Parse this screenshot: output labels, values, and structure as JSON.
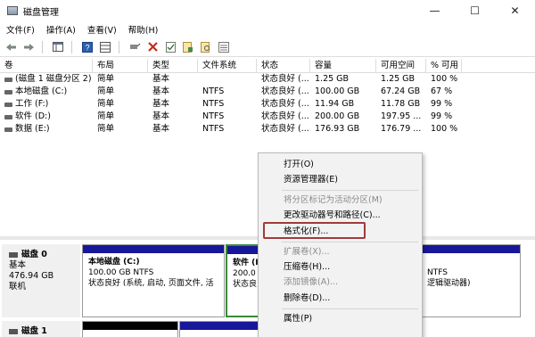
{
  "window": {
    "title": "磁盘管理",
    "minimize": "—",
    "maximize": "☐",
    "close": "✕"
  },
  "menu": [
    "文件(F)",
    "操作(A)",
    "查看(V)",
    "帮助(H)"
  ],
  "toolbar_icons": [
    "back-icon",
    "forward-icon",
    "show-hide-console-icon",
    "help-icon",
    "connect-icon",
    "delete-icon",
    "check-icon",
    "properties-icon",
    "search-icon",
    "list-icon"
  ],
  "list": {
    "headers": [
      "卷",
      "布局",
      "类型",
      "文件系统",
      "状态",
      "容量",
      "可用空间",
      "% 可用"
    ],
    "rows": [
      [
        "(磁盘 1 磁盘分区 2)",
        "简单",
        "基本",
        "",
        "状态良好 (...",
        "1.25 GB",
        "1.25 GB",
        "100 %"
      ],
      [
        "本地磁盘 (C:)",
        "简单",
        "基本",
        "NTFS",
        "状态良好 (...",
        "100.00 GB",
        "67.24 GB",
        "67 %"
      ],
      [
        "工作 (F:)",
        "简单",
        "基本",
        "NTFS",
        "状态良好 (...",
        "11.94 GB",
        "11.78 GB",
        "99 %"
      ],
      [
        "软件 (D:)",
        "简单",
        "基本",
        "NTFS",
        "状态良好 (...",
        "200.00 GB",
        "197.95 ...",
        "99 %"
      ],
      [
        "数据 (E:)",
        "简单",
        "基本",
        "NTFS",
        "状态良好 (...",
        "176.93 GB",
        "176.79 ...",
        "100 %"
      ]
    ]
  },
  "disks": [
    {
      "title": "磁盘 0",
      "type": "基本",
      "size": "476.94 GB",
      "status": "联机"
    },
    {
      "title": "磁盘 1"
    }
  ],
  "partitions": {
    "c_drive": {
      "name": "本地磁盘 (C:)",
      "size": "100.00 GB NTFS",
      "status": "状态良好 (系统, 启动, 页面文件, 活"
    },
    "d_drive": {
      "name": "软件 (I",
      "size": "200.0",
      "status": "状态良"
    },
    "right_part": {
      "size": "NTFS",
      "status": "逻辑驱动器)"
    }
  },
  "context_menu": {
    "open": "打开(O)",
    "explorer": "资源管理器(E)",
    "mark_active": "将分区标记为活动分区(M)",
    "change_letter": "更改驱动器号和路径(C)...",
    "format": "格式化(F)...",
    "extend": "扩展卷(X)...",
    "shrink": "压缩卷(H)...",
    "mirror": "添加镜像(A)...",
    "delete": "删除卷(D)...",
    "properties": "属性(P)"
  }
}
